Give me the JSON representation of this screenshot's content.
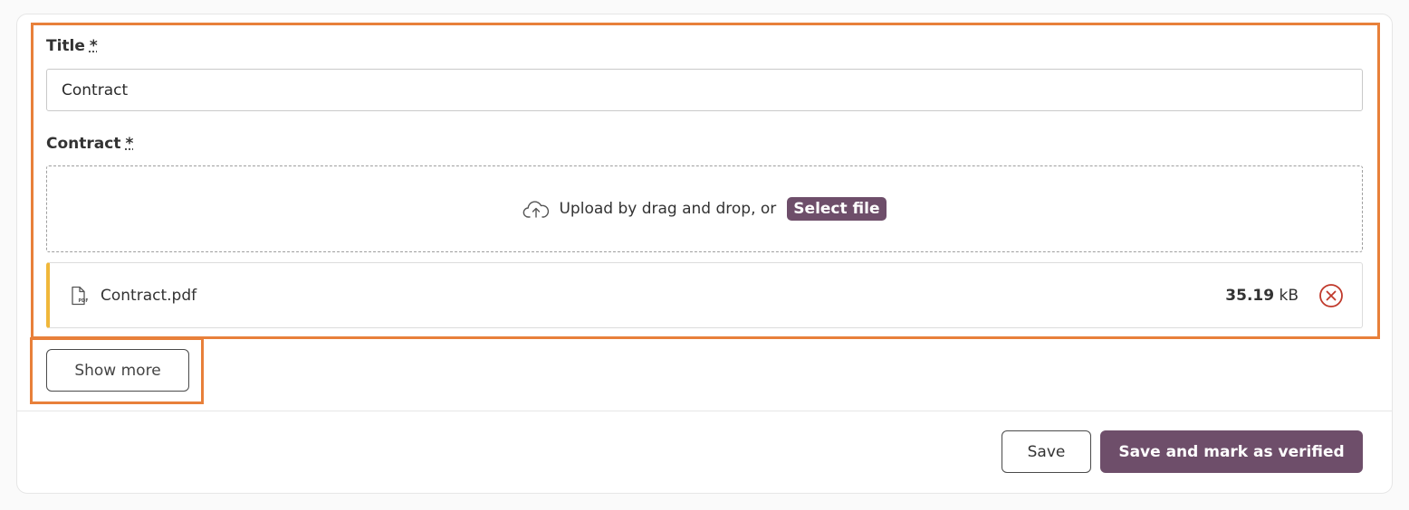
{
  "form": {
    "title_label": "Title",
    "title_required_marker": "*",
    "title_value": "Contract",
    "contract_label": "Contract",
    "contract_required_marker": "*"
  },
  "upload": {
    "prompt": "Upload by drag and drop, or",
    "select_label": "Select file",
    "icon": "cloud-upload-icon"
  },
  "file": {
    "name": "Contract.pdf",
    "size_value": "35.19",
    "size_unit": "kB",
    "icon": "pdf-file-icon",
    "remove_icon": "remove-circle-x-icon",
    "accent_color": "#f0b73a"
  },
  "actions": {
    "show_more_label": "Show more",
    "save_label": "Save",
    "save_verified_label": "Save and mark as verified"
  },
  "colors": {
    "primary": "#6e4e6a",
    "highlight": "#e8803a",
    "danger": "#c0392b"
  }
}
